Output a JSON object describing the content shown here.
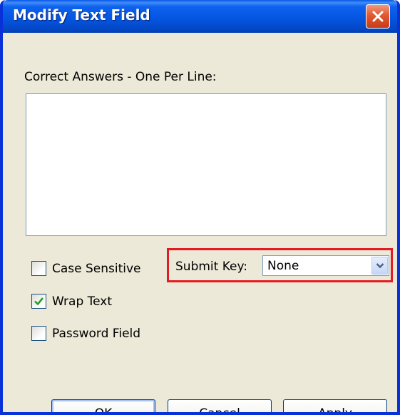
{
  "window": {
    "title": "Modify Text Field",
    "close_icon": "close-icon",
    "accent_color": "#0556e2",
    "close_color": "#e2582f"
  },
  "answers": {
    "label": "Correct Answers - One Per Line:",
    "value": ""
  },
  "options": {
    "case_sensitive": {
      "label": "Case Sensitive",
      "checked": false
    },
    "wrap_text": {
      "label": "Wrap Text",
      "checked": true
    },
    "password_field": {
      "label": "Password Field",
      "checked": false
    }
  },
  "submit_key": {
    "label": "Submit Key:",
    "selected": "None",
    "highlight_color": "#e31b23"
  },
  "buttons": {
    "ok": "OK",
    "cancel": "Cancel",
    "apply": "Apply"
  }
}
